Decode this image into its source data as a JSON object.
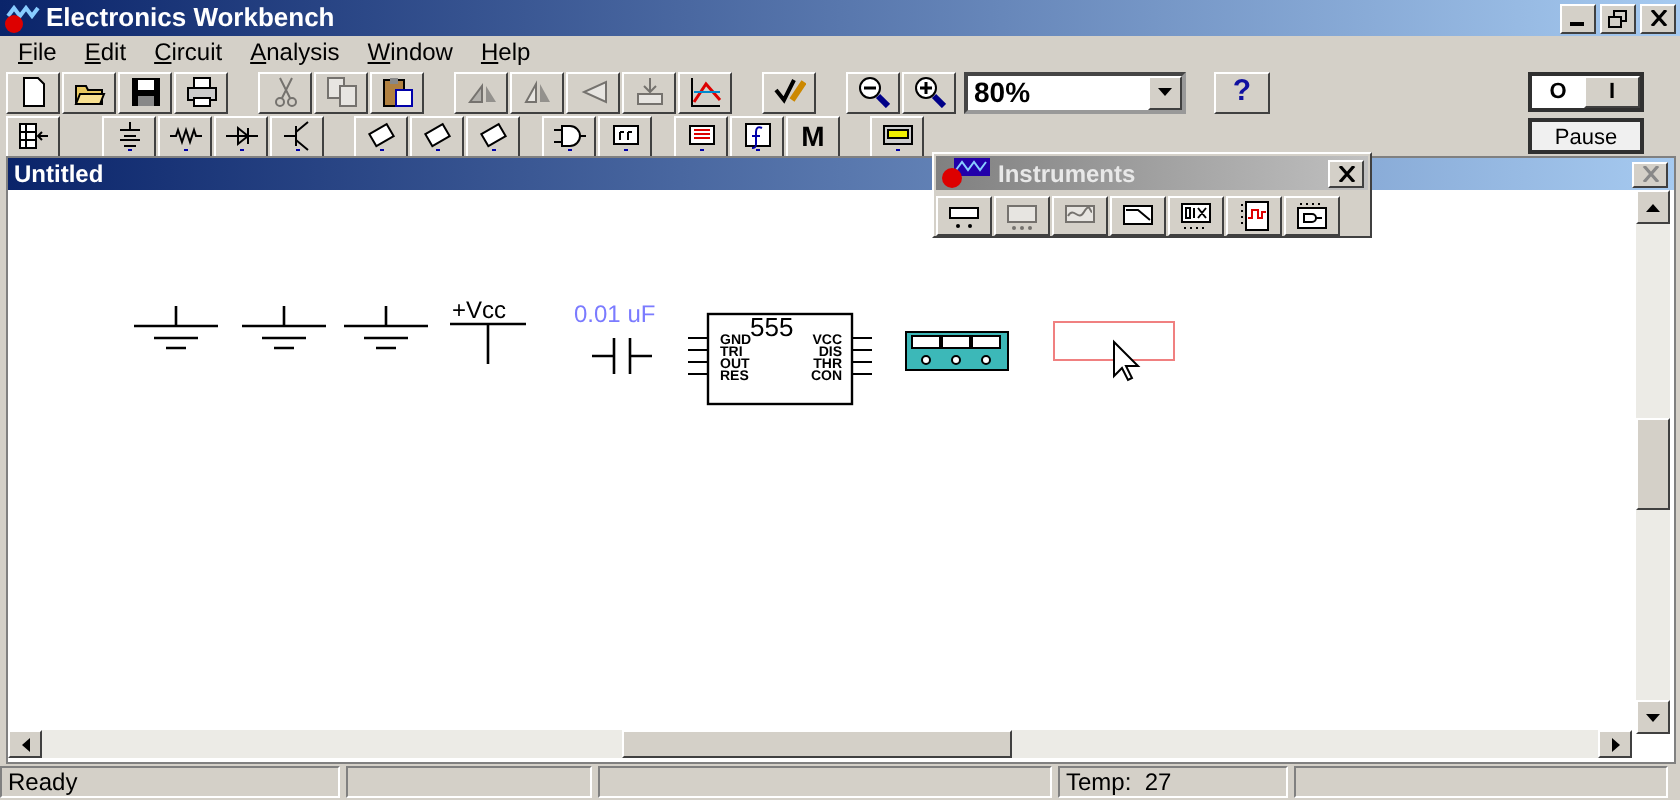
{
  "window": {
    "title": "Electronics Workbench"
  },
  "menu": [
    {
      "label": "File"
    },
    {
      "label": "Edit"
    },
    {
      "label": "Circuit"
    },
    {
      "label": "Analysis"
    },
    {
      "label": "Window"
    },
    {
      "label": "Help"
    }
  ],
  "toolbar_groups": [
    [
      {
        "disabled": false
      },
      {
        "disabled": false
      },
      {
        "disabled": false
      },
      {
        "disabled": false
      }
    ],
    [
      {
        "disabled": true
      },
      {
        "disabled": true
      },
      {
        "disabled": false
      }
    ],
    [
      {
        "disabled": true
      },
      {
        "disabled": true
      },
      {
        "disabled": true
      },
      {
        "disabled": true
      },
      {
        "disabled": false
      }
    ],
    [
      {
        "disabled": false
      }
    ],
    [
      {
        "disabled": false
      },
      {
        "disabled": false
      }
    ]
  ],
  "zoom": {
    "value": "80%"
  },
  "help_button": {
    "label": "?"
  },
  "power_switch": {
    "off_label": "O",
    "on_label": "I",
    "on": false
  },
  "pause_button": {
    "label": "Pause"
  },
  "parts_bin": [
    [
      {
        "kind": "icon"
      }
    ],
    [
      {
        "kind": "icon"
      },
      {
        "kind": "icon"
      },
      {
        "kind": "icon"
      },
      {
        "kind": "icon"
      }
    ],
    [
      {
        "kind": "icon"
      },
      {
        "kind": "icon"
      },
      {
        "kind": "icon"
      }
    ],
    [
      {
        "kind": "icon"
      },
      {
        "kind": "icon"
      }
    ],
    [
      {
        "kind": "icon"
      },
      {
        "kind": "icon"
      },
      {
        "kind": "text",
        "label": "M"
      }
    ],
    [
      {
        "kind": "icon"
      }
    ]
  ],
  "document": {
    "title": "Untitled"
  },
  "instruments": {
    "title": "Instruments",
    "tools": [
      {
        "disabled": false
      },
      {
        "disabled": true
      },
      {
        "disabled": true
      },
      {
        "disabled": false
      },
      {
        "disabled": false
      },
      {
        "disabled": false
      },
      {
        "disabled": false
      }
    ]
  },
  "canvas": {
    "vcc_label": "+Vcc",
    "capacitor_label": "0.01 uF",
    "timer": {
      "title": "555",
      "left_pins": [
        "GND",
        "TRI",
        "OUT",
        "RES"
      ],
      "right_pins": [
        "VCC",
        "DIS",
        "THR",
        "CON"
      ]
    }
  },
  "status_bar": {
    "message": "Ready",
    "temperature": "Temp:  27"
  }
}
